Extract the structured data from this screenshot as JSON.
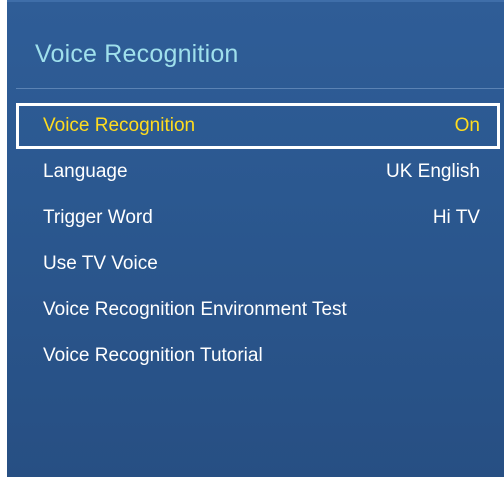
{
  "panel": {
    "title": "Voice Recognition"
  },
  "menu": {
    "items": [
      {
        "label": "Voice Recognition",
        "value": "On",
        "selected": true
      },
      {
        "label": "Language",
        "value": "UK English",
        "selected": false
      },
      {
        "label": "Trigger Word",
        "value": "Hi TV",
        "selected": false
      },
      {
        "label": "Use TV Voice",
        "value": "",
        "selected": false
      },
      {
        "label": "Voice Recognition Environment Test",
        "value": "",
        "selected": false
      },
      {
        "label": "Voice Recognition Tutorial",
        "value": "",
        "selected": false
      }
    ]
  },
  "colors": {
    "panel_background": "#2b5890",
    "title": "#9fe0ec",
    "selected_text": "#ffdc1e",
    "text": "#ffffff",
    "selection_border": "#ffffff"
  }
}
